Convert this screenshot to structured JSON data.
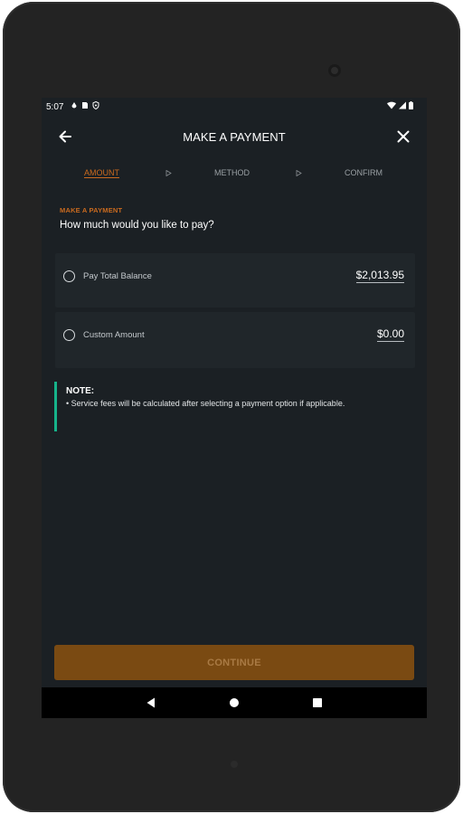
{
  "status_bar": {
    "time": "5:07",
    "left_icons": [
      "drop-icon",
      "sim-card-icon",
      "shield-icon"
    ],
    "right_icons": [
      "wifi-icon",
      "signal-icon",
      "battery-icon"
    ]
  },
  "header": {
    "title": "MAKE A PAYMENT",
    "back_icon": "back-arrow-icon",
    "close_icon": "close-icon"
  },
  "stepper": {
    "steps": [
      "AMOUNT",
      "METHOD",
      "CONFIRM"
    ],
    "active_step": "AMOUNT"
  },
  "section": {
    "label": "MAKE A PAYMENT",
    "question": "How much would you like to pay?"
  },
  "options": [
    {
      "label": "Pay Total Balance",
      "amount": "$2,013.95",
      "selected": false
    },
    {
      "label": "Custom Amount",
      "amount": "$0.00",
      "selected": false
    }
  ],
  "note": {
    "title": "NOTE:",
    "text": "• Service fees will be calculated after selecting a payment option if applicable."
  },
  "continue_label": "CONTINUE",
  "colors": {
    "accent": "#c96a1f",
    "note_bar": "#16b38a",
    "button_bg": "#7a4a12",
    "screen_bg": "#1b2024"
  }
}
